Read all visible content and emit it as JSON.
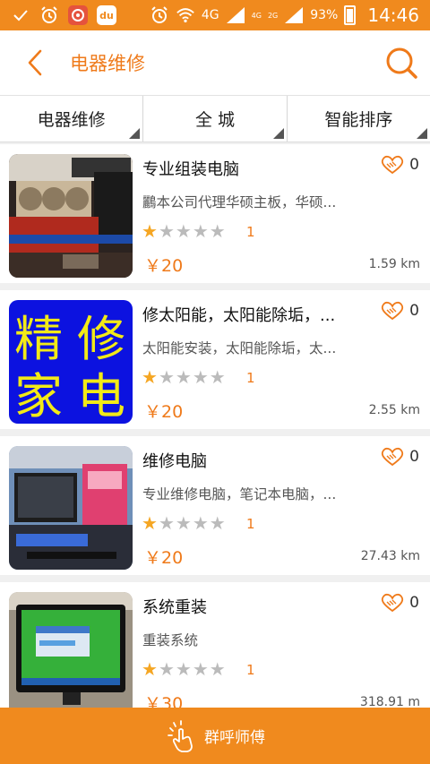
{
  "status_bar": {
    "battery": "93%",
    "time": "14:46",
    "network_4g": "4G",
    "network_4g_small": "4G",
    "network_2g": "2G",
    "app_badge": "du"
  },
  "header": {
    "title": "电器维修"
  },
  "filters": [
    "电器维修",
    "全 城",
    "智能排序"
  ],
  "items": [
    {
      "name": "专业组装电脑",
      "desc": "鸝本公司代理华硕主板，华硕...",
      "rating": 1,
      "rating_count": "1",
      "price": "￥20",
      "distance": "1.59 km",
      "favorites": "0",
      "thumb": "gpu"
    },
    {
      "name": "修太阳能，太阳能除垢，...",
      "desc": "太阳能安装，太阳能除垢，太...",
      "rating": 1,
      "rating_count": "1",
      "price": "￥20",
      "distance": "2.55 km",
      "favorites": "0",
      "thumb": "sign",
      "sign_chars": [
        "精",
        "修",
        "家",
        "电"
      ]
    },
    {
      "name": "维修电脑",
      "desc": "专业维修电脑，笔记本电脑，...",
      "rating": 1,
      "rating_count": "1",
      "price": "￥20",
      "distance": "27.43 km",
      "favorites": "0",
      "thumb": "pc"
    },
    {
      "name": "系统重装",
      "desc": "重装系统",
      "rating": 1,
      "rating_count": "1",
      "price": "￥30",
      "distance": "318.91 m",
      "favorites": "0",
      "thumb": "monitor"
    }
  ],
  "bottom": {
    "label": "群呼师傅"
  },
  "colors": {
    "accent": "#f08a1e",
    "star_on": "#f5a623",
    "star_off": "#bbbbbb"
  }
}
